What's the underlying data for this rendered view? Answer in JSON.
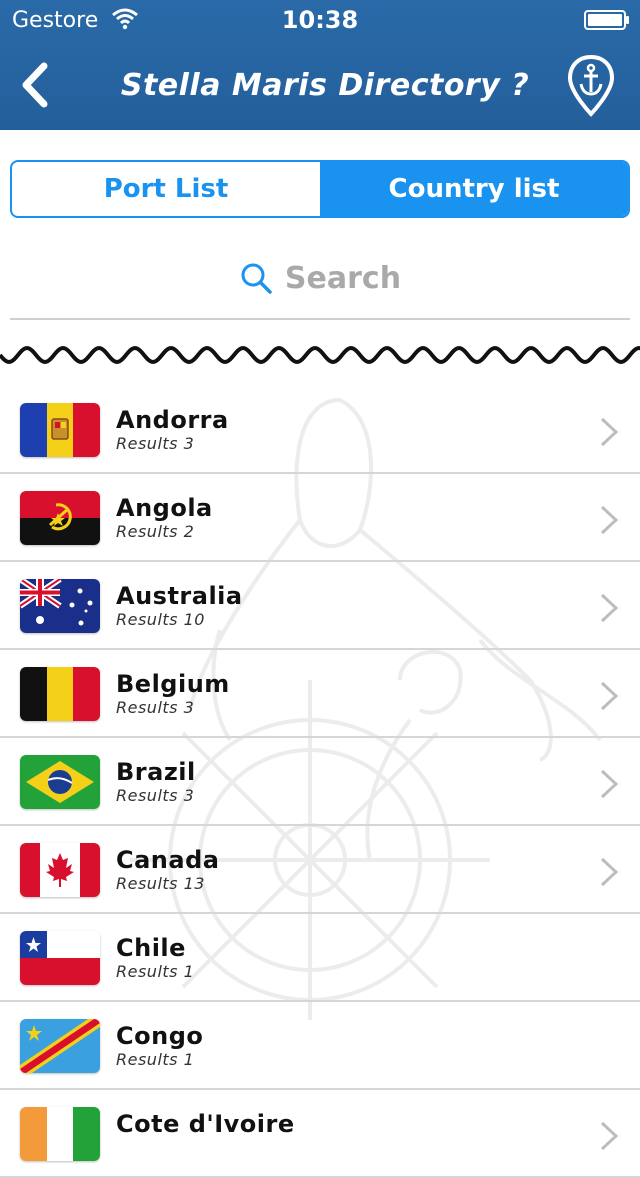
{
  "status_bar": {
    "carrier": "Gestore",
    "time": "10:38"
  },
  "header": {
    "title": "Stella Maris Directory ?"
  },
  "tabs": {
    "port_list": "Port List",
    "country_list": "Country list",
    "active": "country_list"
  },
  "search": {
    "placeholder": "Search"
  },
  "colors": {
    "header_bg": "#2a6aa8",
    "accent": "#1a92f0",
    "separator": "#d6d6d6"
  },
  "countries": [
    {
      "name": "Andorra",
      "results": "Results 3",
      "flag": "andorra-flag",
      "chevron": true
    },
    {
      "name": "Angola",
      "results": "Results 2",
      "flag": "angola-flag",
      "chevron": true
    },
    {
      "name": "Australia",
      "results": "Results 10",
      "flag": "australia-flag",
      "chevron": true
    },
    {
      "name": "Belgium",
      "results": "Results 3",
      "flag": "belgium-flag",
      "chevron": true
    },
    {
      "name": "Brazil",
      "results": "Results 3",
      "flag": "brazil-flag",
      "chevron": true
    },
    {
      "name": "Canada",
      "results": "Results 13",
      "flag": "canada-flag",
      "chevron": true
    },
    {
      "name": "Chile",
      "results": "Results 1",
      "flag": "chile-flag",
      "chevron": false
    },
    {
      "name": "Congo",
      "results": "Results 1",
      "flag": "congo-flag",
      "chevron": false
    },
    {
      "name": "Cote d'Ivoire",
      "results": "",
      "flag": "cote-divoire-flag",
      "chevron": true
    }
  ]
}
